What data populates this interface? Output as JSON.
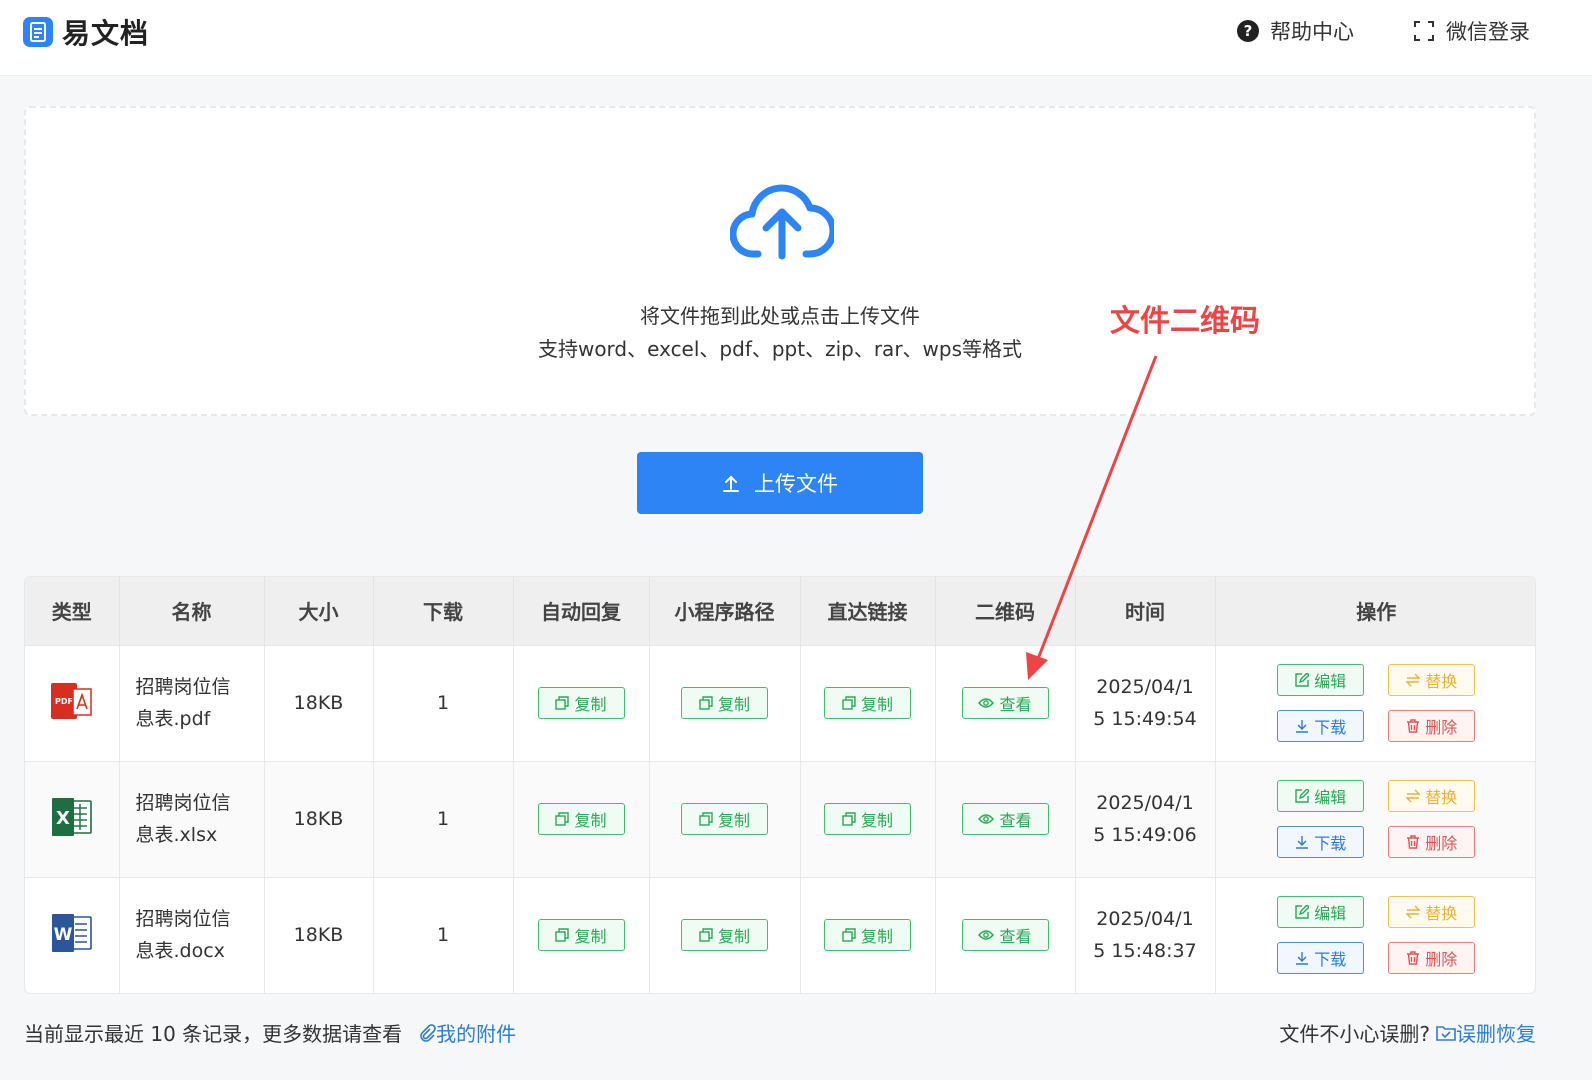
{
  "header": {
    "logo_text": "易文档",
    "help": "帮助中心",
    "login": "微信登录"
  },
  "upload": {
    "hint_line1": "将文件拖到此处或点击上传文件",
    "hint_line2": "支持word、excel、pdf、ppt、zip、rar、wps等格式",
    "button_label": "上传文件"
  },
  "annotation": "文件二维码",
  "table": {
    "headers": [
      "类型",
      "名称",
      "大小",
      "下载",
      "自动回复",
      "小程序路径",
      "直达链接",
      "二维码",
      "时间",
      "操作"
    ],
    "rows": [
      {
        "type": "pdf",
        "name_line1": "招聘岗位信",
        "name_line2": "息表.pdf",
        "size": "18KB",
        "downloads": "1",
        "copy1": "复制",
        "copy2": "复制",
        "copy3": "复制",
        "qrcode": "查看",
        "time_line1": "2025/04/1",
        "time_line2": "5 15:49:54",
        "edit": "编辑",
        "replace": "替换",
        "download": "下载",
        "delete": "删除"
      },
      {
        "type": "xlsx",
        "name_line1": "招聘岗位信",
        "name_line2": "息表.xlsx",
        "size": "18KB",
        "downloads": "1",
        "copy1": "复制",
        "copy2": "复制",
        "copy3": "复制",
        "qrcode": "查看",
        "time_line1": "2025/04/1",
        "time_line2": "5 15:49:06",
        "edit": "编辑",
        "replace": "替换",
        "download": "下载",
        "delete": "删除"
      },
      {
        "type": "docx",
        "name_line1": "招聘岗位信",
        "name_line2": "息表.docx",
        "size": "18KB",
        "downloads": "1",
        "copy1": "复制",
        "copy2": "复制",
        "copy3": "复制",
        "qrcode": "查看",
        "time_line1": "2025/04/1",
        "time_line2": "5 15:48:37",
        "edit": "编辑",
        "replace": "替换",
        "download": "下载",
        "delete": "删除"
      }
    ]
  },
  "footer": {
    "records_text": "当前显示最近 10 条记录，更多数据请查看",
    "attachments_link": "我的附件",
    "recover_prompt": "文件不小心误删?",
    "recover_link": "误删恢复"
  },
  "colors": {
    "accent": "#2d84f4",
    "annotation": "#ef4444",
    "green": "#2aaa55",
    "yellow": "#f0b030",
    "blue": "#2d7cdc",
    "red": "#e55252"
  }
}
